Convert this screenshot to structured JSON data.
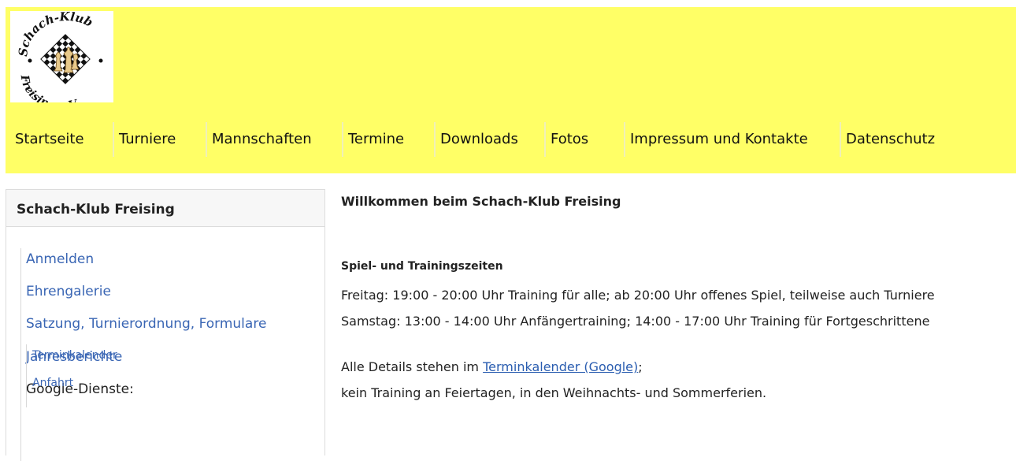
{
  "header": {
    "logo": {
      "text_top": "Schach-Klub",
      "text_bottom": "Freising e.V."
    },
    "nav": [
      {
        "label": "Startseite"
      },
      {
        "label": "Turniere"
      },
      {
        "label": "Mannschaften"
      },
      {
        "label": "Termine"
      },
      {
        "label": "Downloads"
      },
      {
        "label": "Fotos"
      },
      {
        "label": "Impressum und Kontakte"
      },
      {
        "label": "Datenschutz"
      }
    ],
    "background": "#ffff66"
  },
  "sidebar": {
    "title": "Schach-Klub Freising",
    "items": [
      {
        "label": "Anmelden"
      },
      {
        "label": "Ehrengalerie"
      },
      {
        "label": "Satzung, Turnierordnung, Formulare"
      },
      {
        "label": "Jahresberichte"
      }
    ],
    "group_label": "Google-Dienste:",
    "sub_items": [
      {
        "label": "Terminkalender"
      },
      {
        "label": "Anfahrt"
      }
    ],
    "link_color": "#3a66b4"
  },
  "main": {
    "title": "Willkommen beim Schach-Klub Freising",
    "section_title": "Spiel- und Trainingszeiten",
    "line1": "Freitag: 19:00 - 20:00 Uhr Training für alle; ab 20:00 Uhr offenes Spiel, teilweise auch Turniere",
    "line2": "Samstag: 13:00 - 14:00 Uhr Anfängertraining; 14:00 - 17:00 Uhr Training für Fortgeschrittene",
    "line3_prefix": "Alle Details stehen im ",
    "line3_link": "Terminkalender (Google)",
    "line3_suffix": ";",
    "line4": "kein Training an Feiertagen, in den Weihnachts- und Sommerferien."
  }
}
